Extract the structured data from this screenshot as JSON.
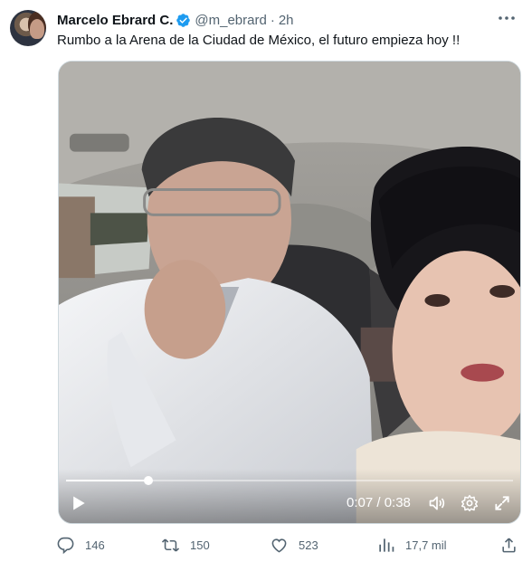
{
  "author": {
    "name": "Marcelo Ebrard C.",
    "handle": "@m_ebrard",
    "separator": "·",
    "time": "2h",
    "verified": true
  },
  "tweet": {
    "text": "Rumbo a la Arena de la Ciudad de México, el futuro empieza hoy !!"
  },
  "video": {
    "timecode": "0:07 / 0:38",
    "progress": 0.184,
    "playing": false
  },
  "actions": {
    "replies": "146",
    "retweets": "150",
    "likes": "523",
    "views": "17,7 mil"
  },
  "colors": {
    "verified": "#1d9bf0",
    "muted": "#536471",
    "text": "#0f1419"
  },
  "icons": [
    "more-icon",
    "verified-badge-icon",
    "play-icon",
    "volume-icon",
    "settings-icon",
    "fullscreen-icon",
    "reply-icon",
    "retweet-icon",
    "like-icon",
    "views-icon",
    "share-icon"
  ]
}
